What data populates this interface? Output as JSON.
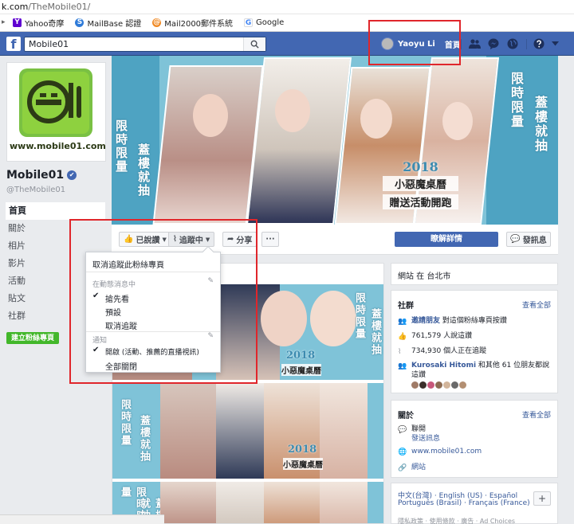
{
  "browser": {
    "url_host": "k.com",
    "url_path": "/TheMobile01/",
    "bookmarks": [
      {
        "label": "Yahoo奇摩",
        "icon": "yahoo-icon",
        "color": "#5f01d1"
      },
      {
        "label": "MailBase 認證",
        "icon": "mailbase-icon",
        "color": "#2f7bd9"
      },
      {
        "label": "Mail2000郵件系統",
        "icon": "mail2000-icon",
        "color": "#f08a24"
      },
      {
        "label": "Google",
        "icon": "google-icon",
        "color": "#dadce0"
      }
    ]
  },
  "fb": {
    "search_value": "Mobile01",
    "user_name": "Yaoyu Li",
    "home_label": "首頁",
    "brand_color": "#4267b2"
  },
  "page": {
    "name": "Mobile01",
    "handle": "@TheMobile01",
    "logo_caption": "www.mobile01.com",
    "nav": [
      "首頁",
      "關於",
      "相片",
      "影片",
      "活動",
      "貼文",
      "社群"
    ],
    "create_page_label": "建立粉絲專頁"
  },
  "cover": {
    "vtext_left": [
      "限時限量",
      "蓋樓就抽"
    ],
    "vtext_right": [
      "限時限量",
      "蓋樓就抽"
    ],
    "badge_year": "2018",
    "badge_line1": "小惡魔桌曆",
    "badge_line2": "贈送活動開跑"
  },
  "actions": {
    "liked_label": "已說讚",
    "following_label": "追蹤中",
    "share_label": "分享",
    "more_label": "···",
    "learn_more_label": "瞭解詳情",
    "message_label": "發訊息"
  },
  "dropdown": {
    "unfollow": "取消追蹤此粉絲專頁",
    "in_feed_header": "在動態消息中",
    "feed_options": [
      "搶先看",
      "預設",
      "取消追蹤"
    ],
    "feed_selected": "搶先看",
    "notify_header": "通知",
    "notify_options": [
      "開啟 (活動、推薦的直播視訊)",
      "全部關閉"
    ],
    "notify_selected": "開啟 (活動、推薦的直播視訊)"
  },
  "feed_posts": [
    {
      "vtext": [
        "限時限量",
        "蓋樓就抽"
      ],
      "year": "2018",
      "caption": "小惡魔桌曆"
    },
    {
      "vtext": [
        "限時限量",
        "蓋樓就抽"
      ],
      "year": "2018",
      "caption": "小惡魔桌曆"
    },
    {
      "vtext": [
        "限時限量",
        "蓋樓就抽"
      ],
      "year": "",
      "caption": ""
    }
  ],
  "right": {
    "location": "網站 在 台北市",
    "community_title": "社群",
    "see_all": "查看全部",
    "invite_link": "邀請朋友",
    "invite_text": " 對這個粉絲專頁按讚",
    "likes_text": "761,579 人說這讚",
    "follows_text": "734,930 個人正在追蹤",
    "friends_name": "Kurosaki Hitomi",
    "friends_text": " 和其他 61 位朋友都說這讚",
    "about_title": "關於",
    "about_see_all": "查看全部",
    "typical_reply": "聯開",
    "send_msg": "發送訊息",
    "website": "www.mobile01.com",
    "category": "網站",
    "languages_line1": "中文(台灣) · English (US) · Español",
    "languages_line2": "Português (Brasil) · Français (France)",
    "plus": "+",
    "footer_partial": "隱私政策 · 使用條款 · 廣告 · Ad Choices"
  }
}
